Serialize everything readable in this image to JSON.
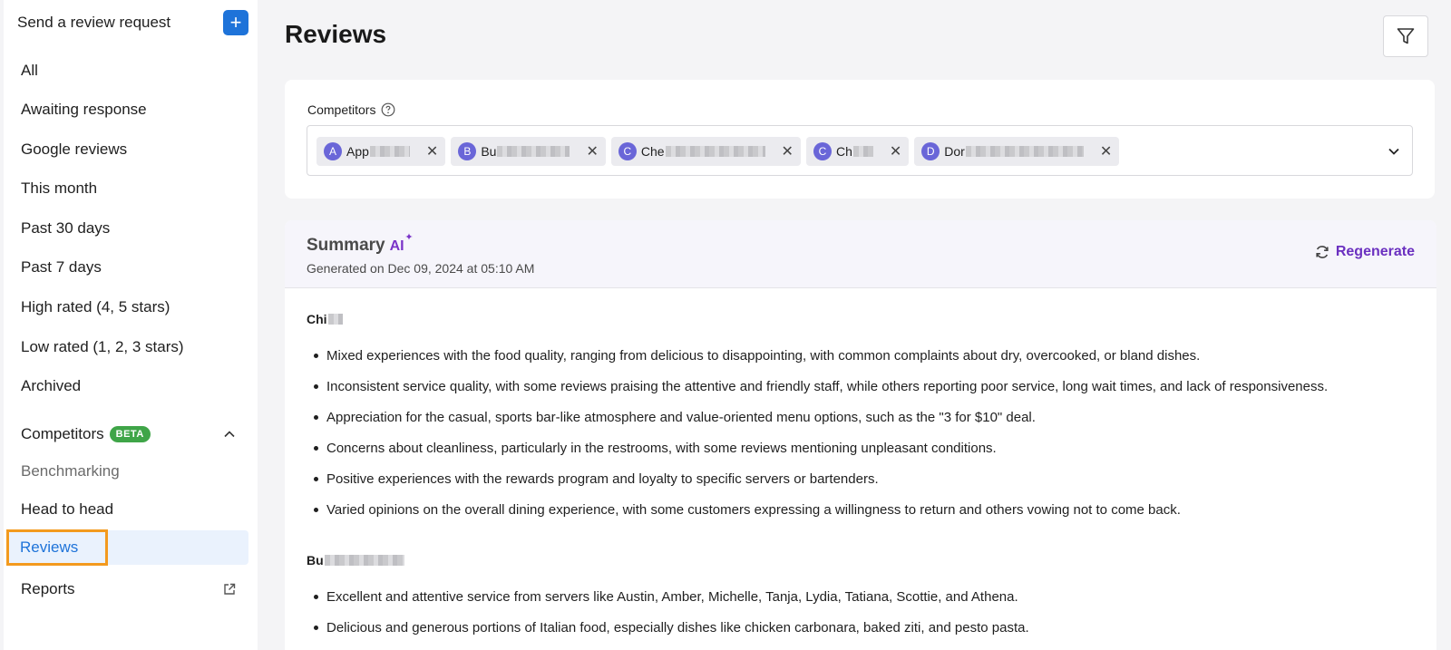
{
  "sidebar": {
    "send_request": "Send a review request",
    "add_symbol": "+",
    "items": [
      {
        "label": "All"
      },
      {
        "label": "Awaiting response"
      },
      {
        "label": "Google reviews"
      },
      {
        "label": "This month"
      },
      {
        "label": "Past 30 days"
      },
      {
        "label": "Past 7 days"
      },
      {
        "label": "High rated (4, 5 stars)"
      },
      {
        "label": "Low rated (1, 2, 3 stars)"
      },
      {
        "label": "Archived"
      }
    ],
    "competitors_section": {
      "label": "Competitors",
      "badge": "BETA"
    },
    "sub_items": [
      {
        "label": "Benchmarking"
      },
      {
        "label": "Head to head"
      },
      {
        "label": "Reviews"
      }
    ],
    "reports": "Reports"
  },
  "page": {
    "title": "Reviews"
  },
  "competitors": {
    "label": "Competitors",
    "chips": [
      {
        "initial": "A",
        "name": "App"
      },
      {
        "initial": "B",
        "name": "Bu"
      },
      {
        "initial": "C",
        "name": "Che"
      },
      {
        "initial": "C",
        "name": "Ch"
      },
      {
        "initial": "D",
        "name": "Dor"
      }
    ],
    "remove_symbol": "✕"
  },
  "summary": {
    "title": "Summary",
    "ai_label": "AI",
    "generated": "Generated on Dec 09, 2024 at 05:10 AM",
    "regenerate": "Regenerate",
    "sections": [
      {
        "name": "Chi",
        "bullets": [
          "Mixed experiences with the food quality, ranging from delicious to disappointing, with common complaints about dry, overcooked, or bland dishes.",
          "Inconsistent service quality, with some reviews praising the attentive and friendly staff, while others reporting poor service, long wait times, and lack of responsiveness.",
          "Appreciation for the casual, sports bar-like atmosphere and value-oriented menu options, such as the \"3 for $10\" deal.",
          "Concerns about cleanliness, particularly in the restrooms, with some reviews mentioning unpleasant conditions.",
          "Positive experiences with the rewards program and loyalty to specific servers or bartenders.",
          "Varied opinions on the overall dining experience, with some customers expressing a willingness to return and others vowing not to come back."
        ]
      },
      {
        "name": "Bu",
        "bullets": [
          "Excellent and attentive service from servers like Austin, Amber, Michelle, Tanja, Lydia, Tatiana, Scottie, and Athena.",
          "Delicious and generous portions of Italian food, especially dishes like chicken carbonara, baked ziti, and pesto pasta."
        ]
      }
    ]
  },
  "colors": {
    "accent": "#1e73d9",
    "ai": "#6b30c0",
    "beta": "#3fa548",
    "highlight": "#f39a1e"
  }
}
